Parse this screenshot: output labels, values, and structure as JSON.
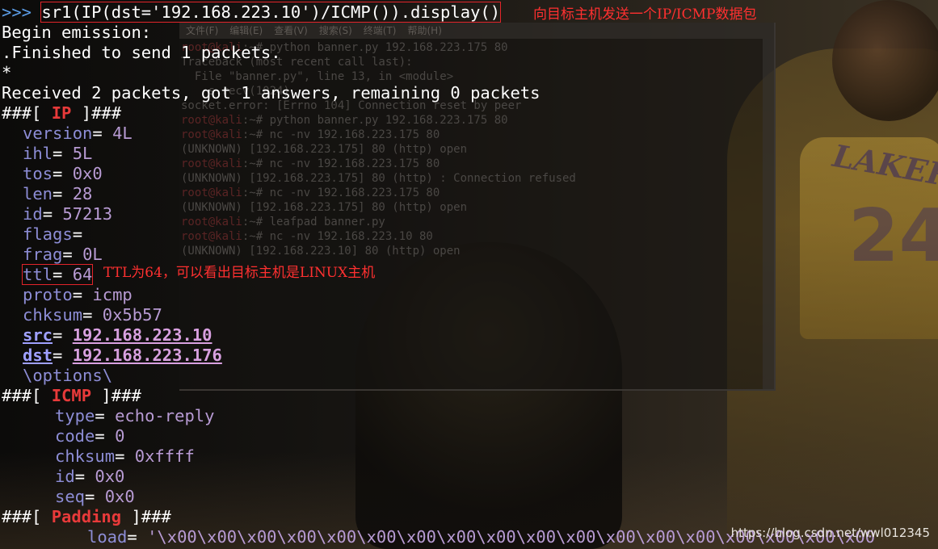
{
  "background_window": {
    "menu": [
      "文件(F)",
      "编辑(E)",
      "查看(V)",
      "搜索(S)",
      "终端(T)",
      "帮助(H)"
    ],
    "lines": [
      {
        "prompt": "root@kali",
        "text": ":~# python banner.py 192.168.223.175 80"
      },
      {
        "prompt": "",
        "text": "Traceback (most recent call last):"
      },
      {
        "prompt": "",
        "text": "  File \"banner.py\", line 13, in <module>"
      },
      {
        "prompt": "",
        "text": "    s.recv(1024)"
      },
      {
        "prompt": "",
        "text": "socket.error: [Errno 104] Connection reset by peer"
      },
      {
        "prompt": "root@kali",
        "text": ":~# python banner.py 192.168.223.175 80"
      },
      {
        "prompt": "root@kali",
        "text": ":~# nc -nv 192.168.223.175 80"
      },
      {
        "prompt": "",
        "text": "(UNKNOWN) [192.168.223.175] 80 (http) open"
      },
      {
        "prompt": "root@kali",
        "text": ":~# nc -nv 192.168.223.175 80"
      },
      {
        "prompt": "",
        "text": "(UNKNOWN) [192.168.223.175] 80 (http) : Connection refused"
      },
      {
        "prompt": "root@kali",
        "text": ":~# nc -nv 192.168.223.175 80"
      },
      {
        "prompt": "",
        "text": "(UNKNOWN) [192.168.223.175] 80 (http) open"
      },
      {
        "prompt": "root@kali",
        "text": ":~# leafpad banner.py"
      },
      {
        "prompt": "root@kali",
        "text": ":~# nc -nv 192.168.223.10 80"
      },
      {
        "prompt": "",
        "text": "(UNKNOWN) [192.168.223.10] 80 (http) open"
      }
    ]
  },
  "terminal": {
    "prompt": ">>>",
    "command": "sr1(IP(dst='192.168.223.10')/ICMP()).display()",
    "begin": "Begin emission:",
    "finished": ".Finished to send 1 packets.",
    "star": "*",
    "received": "Received 2 packets, got 1 answers, remaining 0 packets",
    "layer_prefix": "###[ ",
    "layer_suffix": " ]###",
    "ip_layer": "IP",
    "ip_fields": [
      {
        "name": "version",
        "value": "4L"
      },
      {
        "name": "ihl",
        "value": "5L"
      },
      {
        "name": "tos",
        "value": "0x0"
      },
      {
        "name": "len",
        "value": "28"
      },
      {
        "name": "id",
        "value": "57213"
      },
      {
        "name": "flags",
        "value": ""
      },
      {
        "name": "frag",
        "value": "0L"
      }
    ],
    "ttl": {
      "name": "ttl",
      "value": "64"
    },
    "ip_fields_2": [
      {
        "name": "proto",
        "value": "icmp"
      },
      {
        "name": "chksum",
        "value": "0x5b57"
      }
    ],
    "src": {
      "name": "src",
      "value": "192.168.223.10"
    },
    "dst": {
      "name": "dst",
      "value": "192.168.223.176"
    },
    "options_line": "\\options\\",
    "icmp_layer": "ICMP",
    "icmp_fields": [
      {
        "name": "type",
        "value": "echo-reply"
      },
      {
        "name": "code",
        "value": "0"
      },
      {
        "name": "chksum",
        "value": "0xffff"
      },
      {
        "name": "id",
        "value": "0x0"
      },
      {
        "name": "seq",
        "value": "0x0"
      }
    ],
    "padding_layer": "Padding",
    "load": {
      "name": "load",
      "value": "'\\x00\\x00\\x00\\x00\\x00\\x00\\x00\\x00\\x00\\x00\\x00\\x00\\x00\\x00\\x00\\x00\\x00\\x00"
    }
  },
  "annotations": {
    "command_note": "向目标主机发送一个IP/ICMP数据包",
    "ttl_note": "TTL为64，可以看出目标主机是LINUX主机"
  },
  "watermark": "https://blog.csdn.net/wwl012345"
}
